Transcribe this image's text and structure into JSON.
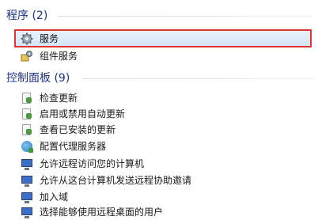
{
  "groups": {
    "programs": {
      "title": "程序 (2)",
      "items": [
        "服务",
        "组件服务"
      ]
    },
    "control_panel": {
      "title": "控制面板 (9)",
      "items": [
        "检查更新",
        "启用或禁用自动更新",
        "查看已安装的更新",
        "配置代理服务器",
        "允许远程访问您的计算机",
        "允许从这台计算机发送远程协助邀请",
        "加入域",
        "选择能够使用远程桌面的用户"
      ]
    }
  },
  "icons": [
    "gear-icon",
    "component-services-icon",
    "update-icon",
    "network-icon",
    "monitor-icon"
  ],
  "colors": {
    "group_title": "#1e3287",
    "selection_border": "#e03333",
    "selection_fill": "#dce9f8"
  }
}
